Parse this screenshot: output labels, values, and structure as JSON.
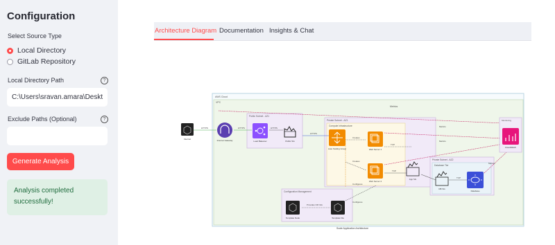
{
  "sidebar": {
    "title": "Configuration",
    "source_type_label": "Select Source Type",
    "options": [
      {
        "label": "Local Directory",
        "selected": true
      },
      {
        "label": "GitLab Repository",
        "selected": false
      }
    ],
    "path_label": "Local Directory Path",
    "path_value": "C:\\Users\\sravan.amara\\Deskt",
    "exclude_label": "Exclude Paths (Optional)",
    "exclude_value": "",
    "help_icon": "question-circle-icon",
    "generate_button": "Generate Analysis",
    "success_message": "Analysis completed successfully!"
  },
  "tabs": [
    {
      "label": "Architecture Diagram",
      "active": true
    },
    {
      "label": "Documentation",
      "active": false
    },
    {
      "label": "Insights & Chat",
      "active": false
    }
  ],
  "colors": {
    "accent": "#ff4b4b",
    "sidebar_bg": "#f0f2f6",
    "success_bg": "#dff0e5",
    "success_text": "#1e6b3c"
  },
  "diagram": {
    "cloud": "AWS Cloud",
    "vpc": "VPC",
    "metrics_top": "Metrics",
    "public_subnet": "Public Subnet - AZ1",
    "private_subnet": "Private Subnet - AZ1",
    "compute": "Compute Infrastructure",
    "private_subnet2": "Private Subnet - AZ2",
    "database_tier": "Database Tier",
    "config_mgmt": "Configuration Management",
    "nodes": {
      "internet": "Internet",
      "gateway": "Internet Gateway",
      "lb": "Load Balancer",
      "public_sg": "Public SG",
      "asg": "Auto Scaling Group",
      "web1": "Web Server 1",
      "web2": "Web Server 2",
      "app_sg": "App SG",
      "db_sg": "DB SG",
      "database": "Database",
      "cloudwatch": "CloudWatch",
      "monitoring": "Monitoring",
      "template_node": "Template Node",
      "template_file": "Template File"
    },
    "edges": {
      "https1": "HTTPS",
      "https2": "HTTPS",
      "https3": "HTTPS",
      "https4": "HTTPS",
      "creates1": "Creates",
      "creates2": "Creates",
      "tcp1": "TCP",
      "tcp2": "TCP",
      "tcp3": "TCP",
      "metrics1": "Metrics",
      "metrics2": "Metrics",
      "metrics3": "Metrics",
      "configures1": "Configures",
      "configures2": "Configures",
      "provides": "Provides CM Info"
    },
    "caption": "Scale Application Architecture"
  }
}
